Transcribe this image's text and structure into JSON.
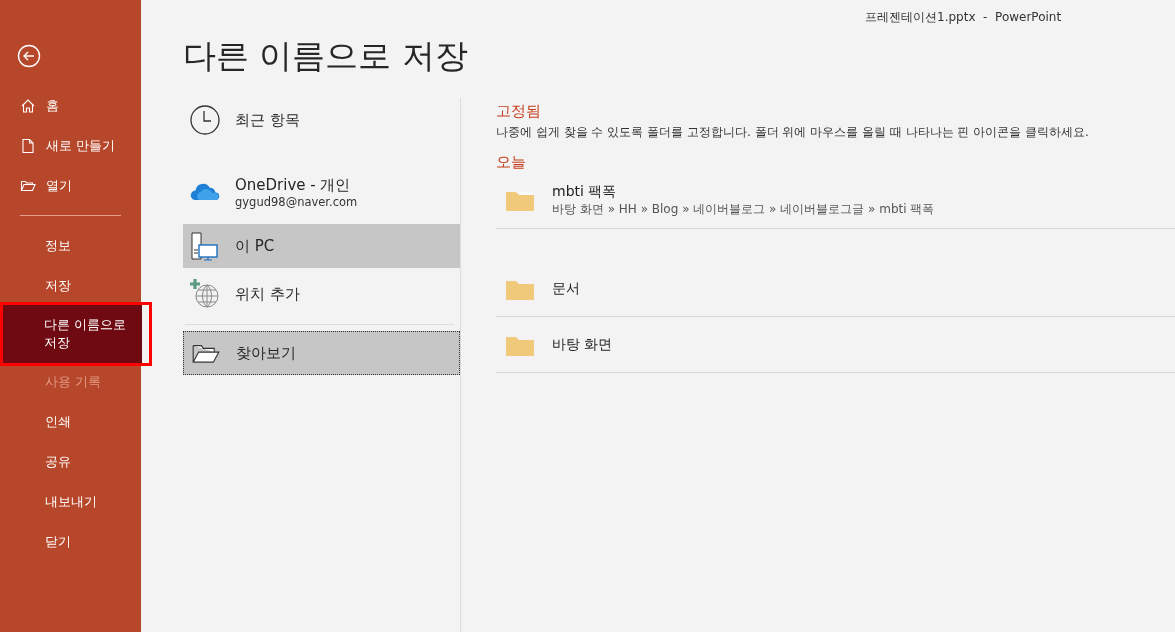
{
  "window": {
    "title": "프레젠테이션1.pptx  -  PowerPoint"
  },
  "sidebar": {
    "top_items": [
      {
        "label": "홈",
        "kind": "home"
      },
      {
        "label": "새로 만들기",
        "kind": "new"
      },
      {
        "label": "열기",
        "kind": "open"
      }
    ],
    "items": [
      {
        "label": "정보",
        "selected": false,
        "disabled": false
      },
      {
        "label": "저장",
        "selected": false,
        "disabled": false
      },
      {
        "label": "다른 이름으로 저장",
        "selected": true,
        "disabled": false
      },
      {
        "label": "사용 기록",
        "selected": false,
        "disabled": true
      },
      {
        "label": "인쇄",
        "selected": false,
        "disabled": false
      },
      {
        "label": "공유",
        "selected": false,
        "disabled": false
      },
      {
        "label": "내보내기",
        "selected": false,
        "disabled": false
      },
      {
        "label": "닫기",
        "selected": false,
        "disabled": false
      }
    ]
  },
  "page_title": "다른 이름으로 저장",
  "locations": [
    {
      "kind": "recent",
      "label": "최근 항목",
      "selected": false,
      "focused": false
    },
    {
      "kind": "onedrive",
      "label": "OneDrive - 개인",
      "subtitle": "gygud98@naver.com",
      "selected": false,
      "focused": false
    },
    {
      "kind": "pc",
      "label": "이 PC",
      "selected": true,
      "focused": false
    },
    {
      "kind": "add",
      "label": "위치 추가",
      "selected": false,
      "focused": false
    },
    {
      "kind": "browse",
      "label": "찾아보기",
      "selected": true,
      "focused": true
    }
  ],
  "pinned": {
    "heading": "고정됨",
    "description": "나중에 쉽게 찾을 수 있도록 폴더를 고정합니다. 폴더 위에 마우스를 올릴 때 나타나는 핀 아이콘을 클릭하세요."
  },
  "today": {
    "heading": "오늘",
    "folders": [
      {
        "name": "mbti 팩폭",
        "path": "바탕 화면 » HH » Blog » 네이버블로그 » 네이버블로그글 » mbti 팩폭"
      }
    ]
  },
  "older": {
    "folders": [
      {
        "name": "문서"
      },
      {
        "name": "바탕 화면"
      }
    ]
  }
}
